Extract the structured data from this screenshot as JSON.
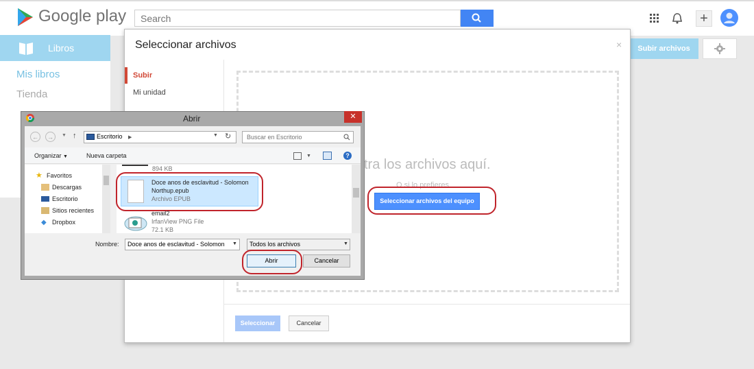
{
  "header": {
    "brand": "Google play",
    "search_placeholder": "Search",
    "plus_symbol": "+"
  },
  "nav": {
    "libros": "Libros",
    "mis_libros": "Mis libros",
    "tienda": "Tienda"
  },
  "toolbar": {
    "subir_archivos": "Subir archivos"
  },
  "modal": {
    "title": "Seleccionar archivos",
    "close": "×",
    "tabs": [
      "Subir",
      "Mi unidad"
    ],
    "drop_text": "stra los archivos aquí.",
    "drop_or": "O si lo prefieres",
    "pick_button": "Seleccionar archivos del equipo",
    "select_button": "Seleccionar",
    "cancel_button": "Cancelar"
  },
  "dialog": {
    "title": "Abrir",
    "address": "Escritorio",
    "search_placeholder": "Buscar en Escritorio",
    "organize": "Organizar",
    "new_folder": "Nueva carpeta",
    "favorites_header": "Favoritos",
    "favorites": [
      "Descargas",
      "Escritorio",
      "Sitios recientes",
      "Dropbox"
    ],
    "files": [
      {
        "size": "894 KB"
      },
      {
        "name_line1": "Doce anos de esclavitud - Solomon",
        "name_line2": "Northup.epub",
        "type": "Archivo EPUB"
      },
      {
        "name": "email2",
        "type": "IrfanView PNG File",
        "size": "72.1 KB"
      }
    ],
    "name_label": "Nombre:",
    "name_value": "Doce anos de esclavitud - Solomon",
    "filter": "Todos los archivos",
    "open_button": "Abrir",
    "cancel_button": "Cancelar"
  },
  "colors": {
    "accent_blue": "#4285f4",
    "libros_blue": "#9fd6f0",
    "highlight_red": "#c0242b"
  }
}
